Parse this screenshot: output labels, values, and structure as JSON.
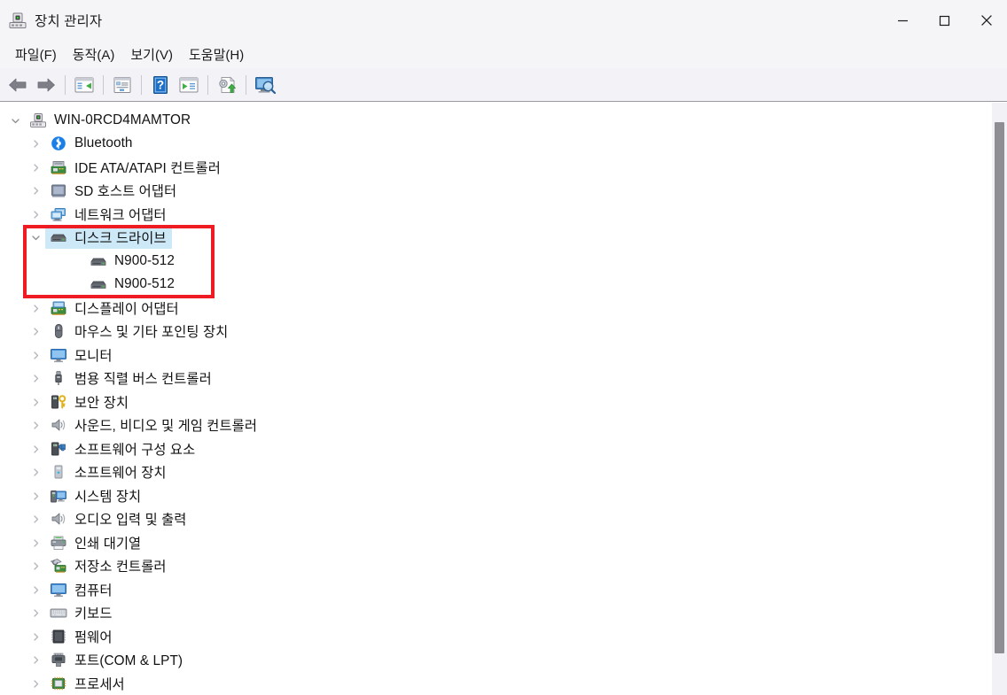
{
  "window": {
    "title": "장치 관리자",
    "title_icon": "device-manager-icon",
    "controls": {
      "minimize": "최소화",
      "maximize": "최대화",
      "close": "닫기"
    }
  },
  "menubar": {
    "items": [
      {
        "label": "파일(F)",
        "name": "menu-file"
      },
      {
        "label": "동작(A)",
        "name": "menu-action"
      },
      {
        "label": "보기(V)",
        "name": "menu-view"
      },
      {
        "label": "도움말(H)",
        "name": "menu-help"
      }
    ]
  },
  "toolbar": {
    "buttons": [
      {
        "icon": "back-arrow-icon",
        "label": "뒤로"
      },
      {
        "icon": "forward-arrow-icon",
        "label": "앞으로"
      },
      {
        "icon": "show-hide-console-tree-icon",
        "label": "콘솔 트리 표시/숨기기"
      },
      {
        "icon": "properties-icon",
        "label": "속성"
      },
      {
        "icon": "help-icon",
        "label": "도움말"
      },
      {
        "icon": "action-menu-icon",
        "label": "동작 메뉴"
      },
      {
        "icon": "update-driver-icon",
        "label": "드라이버 업데이트"
      },
      {
        "icon": "scan-hardware-changes-icon",
        "label": "하드웨어 변경 사항 검색"
      }
    ]
  },
  "tree": {
    "root": {
      "label": "WIN-0RCD4MAMTOR",
      "icon": "computer-root-icon",
      "expanded": true
    },
    "nodes": [
      {
        "label": "Bluetooth",
        "icon": "bluetooth-icon",
        "depth": 1,
        "expanded": false,
        "selected": false
      },
      {
        "label": "IDE ATA/ATAPI 컨트롤러",
        "icon": "ide-controller-icon",
        "depth": 1,
        "expanded": false,
        "selected": false
      },
      {
        "label": "SD 호스트 어댑터",
        "icon": "sd-host-adapter-icon",
        "depth": 1,
        "expanded": false,
        "selected": false
      },
      {
        "label": "네트워크 어댑터",
        "icon": "network-adapter-icon",
        "depth": 1,
        "expanded": false,
        "selected": false
      },
      {
        "label": "디스크 드라이브",
        "icon": "disk-drive-icon",
        "depth": 1,
        "expanded": true,
        "selected": true
      },
      {
        "label": "N900-512",
        "icon": "disk-drive-icon",
        "depth": 2,
        "expanded": null,
        "selected": false
      },
      {
        "label": "N900-512",
        "icon": "disk-drive-icon",
        "depth": 2,
        "expanded": null,
        "selected": false
      },
      {
        "label": "디스플레이 어댑터",
        "icon": "display-adapter-icon",
        "depth": 1,
        "expanded": false,
        "selected": false
      },
      {
        "label": "마우스 및 기타 포인팅 장치",
        "icon": "mouse-icon",
        "depth": 1,
        "expanded": false,
        "selected": false
      },
      {
        "label": "모니터",
        "icon": "monitor-icon",
        "depth": 1,
        "expanded": false,
        "selected": false
      },
      {
        "label": "범용 직렬 버스 컨트롤러",
        "icon": "usb-controller-icon",
        "depth": 1,
        "expanded": false,
        "selected": false
      },
      {
        "label": "보안 장치",
        "icon": "security-device-icon",
        "depth": 1,
        "expanded": false,
        "selected": false
      },
      {
        "label": "사운드, 비디오 및 게임 컨트롤러",
        "icon": "sound-video-game-icon",
        "depth": 1,
        "expanded": false,
        "selected": false
      },
      {
        "label": "소프트웨어 구성 요소",
        "icon": "software-component-icon",
        "depth": 1,
        "expanded": false,
        "selected": false
      },
      {
        "label": "소프트웨어 장치",
        "icon": "software-device-icon",
        "depth": 1,
        "expanded": false,
        "selected": false
      },
      {
        "label": "시스템 장치",
        "icon": "system-device-icon",
        "depth": 1,
        "expanded": false,
        "selected": false
      },
      {
        "label": "오디오 입력 및 출력",
        "icon": "audio-io-icon",
        "depth": 1,
        "expanded": false,
        "selected": false
      },
      {
        "label": "인쇄 대기열",
        "icon": "print-queue-icon",
        "depth": 1,
        "expanded": false,
        "selected": false
      },
      {
        "label": "저장소 컨트롤러",
        "icon": "storage-controller-icon",
        "depth": 1,
        "expanded": false,
        "selected": false
      },
      {
        "label": "컴퓨터",
        "icon": "computer-icon",
        "depth": 1,
        "expanded": false,
        "selected": false
      },
      {
        "label": "키보드",
        "icon": "keyboard-icon",
        "depth": 1,
        "expanded": false,
        "selected": false
      },
      {
        "label": "펌웨어",
        "icon": "firmware-icon",
        "depth": 1,
        "expanded": false,
        "selected": false
      },
      {
        "label": "포트(COM & LPT)",
        "icon": "ports-icon",
        "depth": 1,
        "expanded": false,
        "selected": false
      },
      {
        "label": "프로세서",
        "icon": "processor-icon",
        "depth": 1,
        "expanded": false,
        "selected": false
      }
    ]
  },
  "annotation": {
    "name": "red-highlight-box",
    "color": "#ee1b22",
    "target": "디스크 드라이브"
  },
  "scrollbar": {
    "name": "vertical-scrollbar",
    "thumb_color": "#8e8e94"
  },
  "colors": {
    "selection": "#cde8f7",
    "titlebar_bg": "#f5f5f8",
    "toolbar_bg": "#f3f3f7",
    "pane_bg": "#ffffff",
    "annotation": "#ee1b22"
  }
}
